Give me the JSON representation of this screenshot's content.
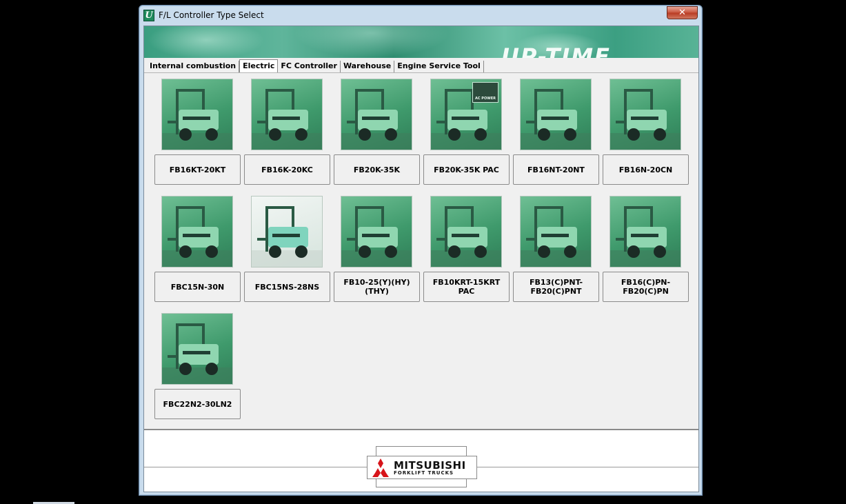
{
  "window": {
    "title": "F/L Controller Type Select",
    "close_glyph": "✕",
    "app_icon_glyph": "U"
  },
  "banner": {
    "text": "UP-TIME"
  },
  "tabs": [
    {
      "label": "Internal combustion",
      "active": false
    },
    {
      "label": "Electric",
      "active": true
    },
    {
      "label": "FC Controller",
      "active": false
    },
    {
      "label": "Warehouse",
      "active": false
    },
    {
      "label": "Engine Service Tool",
      "active": false
    }
  ],
  "models": [
    {
      "label": "FB16KT-20KT",
      "icon": "forklift-photo"
    },
    {
      "label": "FB16K-20KC",
      "icon": "forklift-photo"
    },
    {
      "label": "FB20K-35K",
      "icon": "forklift-photo"
    },
    {
      "label": "FB20K-35K PAC",
      "icon": "forklift-photo",
      "badge": "AC POWER"
    },
    {
      "label": "FB16NT-20NT",
      "icon": "forklift-photo"
    },
    {
      "label": "FB16N-20CN",
      "icon": "forklift-photo"
    },
    {
      "label": "FBC15N-30N",
      "icon": "forklift-photo"
    },
    {
      "label": "FBC15NS-28NS",
      "icon": "forklift-photo"
    },
    {
      "label": "FB10-25(Y)(HY)(THY)",
      "icon": "forklift-photo"
    },
    {
      "label": "FB10KRT-15KRT PAC",
      "icon": "forklift-photo"
    },
    {
      "label": "FB13(C)PNT-FB20(C)PNT",
      "icon": "forklift-photo"
    },
    {
      "label": "FB16(C)PN-FB20(C)PN",
      "icon": "forklift-photo"
    },
    {
      "label": "FBC22N2-30LN2",
      "icon": "forklift-photo"
    }
  ],
  "footer": {
    "logo_name": "MITSUBISHI",
    "logo_sub": "FORKLIFT TRUCKS"
  },
  "colors": {
    "accent_green": "#3f9a6c",
    "logo_red": "#d7141a"
  }
}
